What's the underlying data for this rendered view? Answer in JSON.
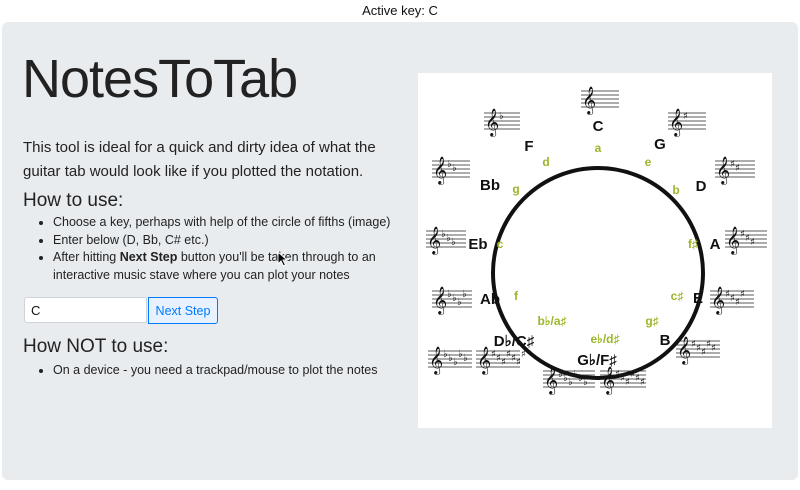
{
  "top_bar": {
    "text": "Active key: C"
  },
  "main": {
    "title": "NotesToTab",
    "lead": "This tool is ideal for a quick and dirty idea of what the guitar tab would look like if you plotted the notation.",
    "how_to_use": {
      "heading": "How to use:",
      "items": [
        {
          "text": "Choose a key, perhaps with help of the circle of fifths (image)"
        },
        {
          "text": "Enter below (D, Bb, C# etc.)"
        },
        {
          "prefix": "After hitting ",
          "bold": "Next Step",
          "suffix": " button you'll be taken through to an interactive music stave where you can plot your notes"
        }
      ]
    },
    "key_input": {
      "value": "C"
    },
    "next_button": {
      "label": "Next Step"
    },
    "how_not": {
      "heading": "How NOT to use:",
      "items": [
        {
          "text": "On a device - you need a trackpad/mouse to plot the notes"
        }
      ]
    }
  },
  "circle_of_fifths": {
    "major_labels": [
      {
        "text": "C"
      },
      {
        "text": "G"
      },
      {
        "text": "D"
      },
      {
        "text": "A"
      },
      {
        "text": "E"
      },
      {
        "text": "B"
      },
      {
        "text": "G♭/F♯"
      },
      {
        "text": "D♭/C♯"
      },
      {
        "text": "Ab"
      },
      {
        "text": "Eb"
      },
      {
        "text": "Bb"
      },
      {
        "text": "F"
      }
    ],
    "minor_labels": [
      {
        "text": "a"
      },
      {
        "text": "e"
      },
      {
        "text": "b"
      },
      {
        "text": "f♯"
      },
      {
        "text": "c♯"
      },
      {
        "text": "g♯"
      },
      {
        "text": "e♭/d♯"
      },
      {
        "text": "b♭/a♯"
      },
      {
        "text": "f"
      },
      {
        "text": "c"
      },
      {
        "text": "g"
      },
      {
        "text": "d"
      }
    ],
    "colors": {
      "major": "#111111",
      "minor": "#9bb62a",
      "ring": "#111111"
    }
  }
}
